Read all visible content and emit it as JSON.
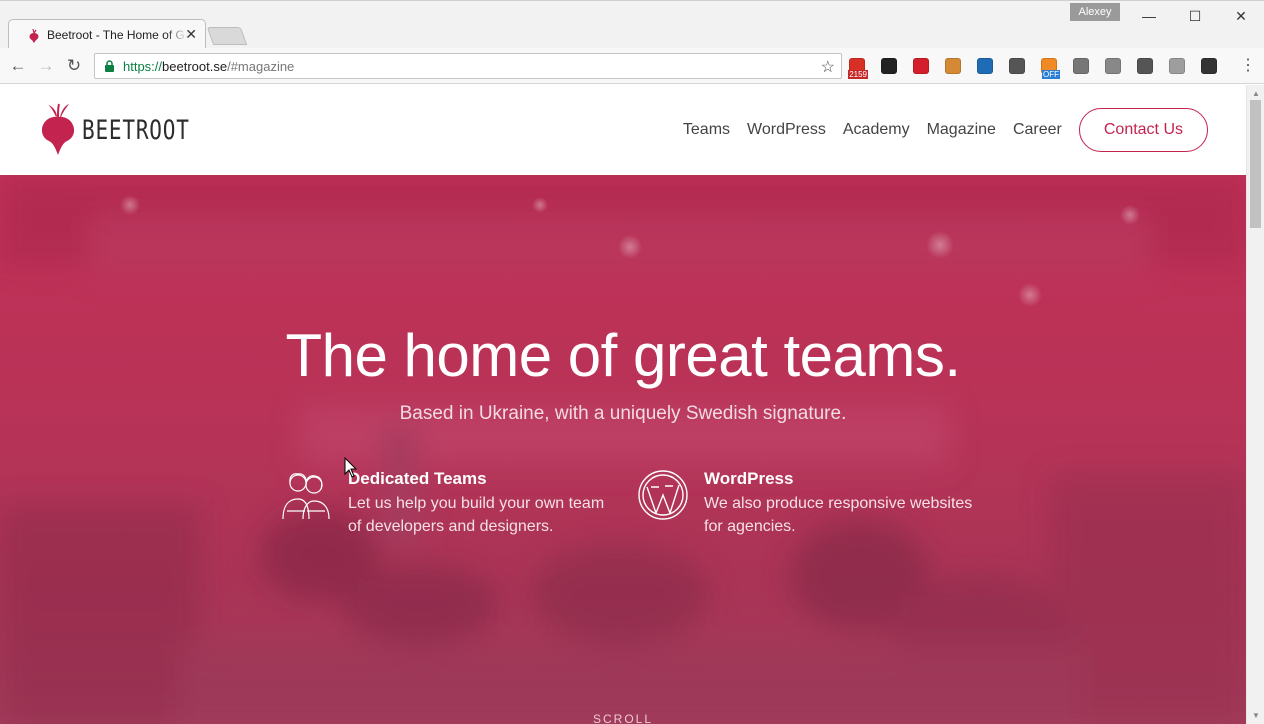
{
  "browser": {
    "tab_title": "Beetroot - The Home of Great Teams",
    "profile_name": "Alexey",
    "url_scheme": "https://",
    "url_host": "beetroot.se",
    "url_rest": "/#magazine",
    "extensions": [
      {
        "name": "gmail-icon",
        "badge": "2159",
        "color": "#d93025"
      },
      {
        "name": "gear-icon",
        "color": "#222222"
      },
      {
        "name": "opera-icon",
        "color": "#d41e2b"
      },
      {
        "name": "cookie-icon",
        "color": "#d48a35"
      },
      {
        "name": "yoast-icon",
        "color": "#1f6bb6"
      },
      {
        "name": "screencast-icon",
        "color": "#555555"
      },
      {
        "name": "off-toggle-icon",
        "badge": "OFF",
        "color": "#f08a24"
      },
      {
        "name": "s-extension-icon",
        "color": "#777777"
      },
      {
        "name": "fragment-icon",
        "color": "#888888"
      },
      {
        "name": "wordpress-icon",
        "color": "#555555"
      },
      {
        "name": "drive-icon",
        "color": "#9e9e9e"
      },
      {
        "name": "lightbulb-icon",
        "color": "#333333"
      }
    ]
  },
  "site": {
    "logo_text": "BEETROOT",
    "nav": [
      "Teams",
      "WordPress",
      "Academy",
      "Magazine",
      "Career"
    ],
    "contact_label": "Contact Us",
    "accent": "#c3244f"
  },
  "hero": {
    "title": "The home of great teams.",
    "subtitle": "Based in Ukraine, with a uniquely Swedish signature.",
    "features": [
      {
        "title": "Dedicated Teams",
        "desc": "Let us help you build your own team of developers and designers."
      },
      {
        "title": "WordPress",
        "desc": "We also produce responsive websites for agencies."
      }
    ],
    "scroll_label": "SCROLL"
  }
}
